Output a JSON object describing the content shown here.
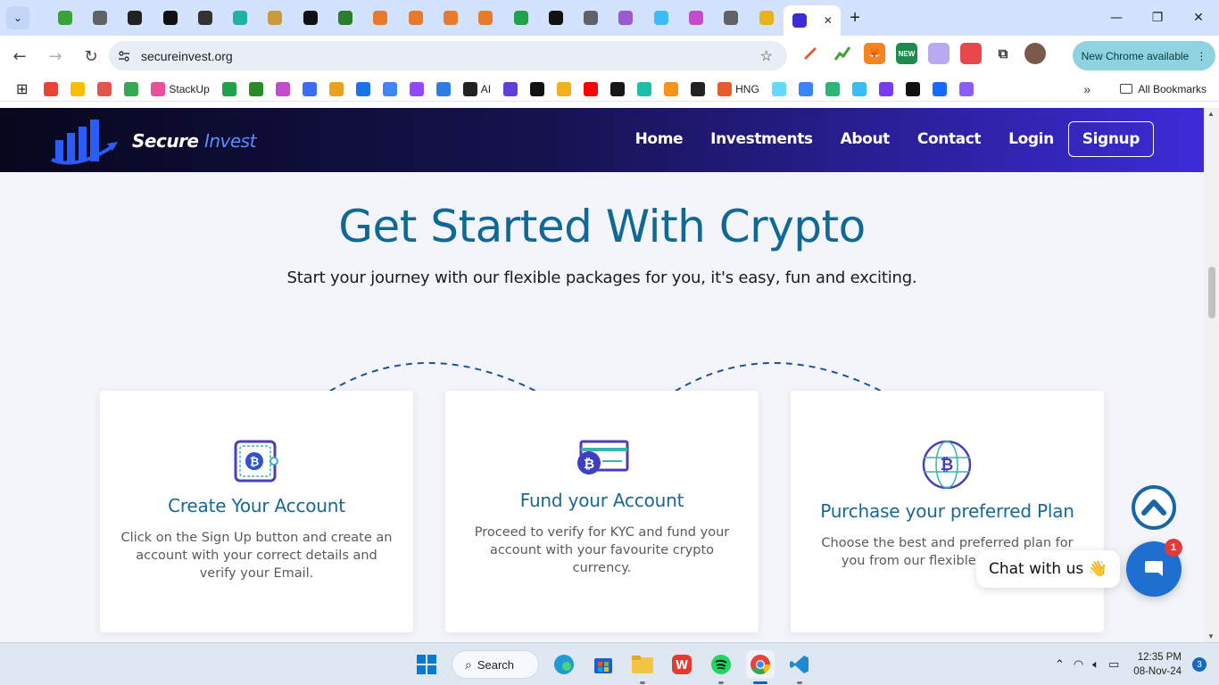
{
  "browser": {
    "tab_count_icons": [
      "chart-icon",
      "globe-icon",
      "tradingview-icon",
      "notion-icon",
      "openai-icon",
      "app-icon",
      "pinata-icon",
      "x-icon",
      "leaf-icon",
      "link-icon",
      "link-icon",
      "link-icon",
      "link-icon",
      "badge-85-icon",
      "block-icon",
      "globe-icon",
      "pin-icon",
      "wave-icon",
      "react-icon",
      "globe-icon",
      "bot-icon",
      "secureinvest-icon"
    ],
    "active_tab_close": "✕",
    "new_tab": "+",
    "url": "secureinvest.org",
    "update_button": "New Chrome available",
    "update_more": "⋮",
    "bookmarks": [
      {
        "label": "",
        "color": "#ea4335"
      },
      {
        "label": "",
        "color": "#fbbc04"
      },
      {
        "label": "",
        "color": "#e0564b"
      },
      {
        "label": "",
        "color": "#34a853"
      },
      {
        "label": "StackUp",
        "color": "#e94f9b"
      },
      {
        "label": "",
        "color": "#1fa34a"
      },
      {
        "label": "",
        "color": "#2a8a2a"
      },
      {
        "label": "",
        "color": "#c44bc9"
      },
      {
        "label": "",
        "color": "#3a6df0"
      },
      {
        "label": "",
        "color": "#e8a31c"
      },
      {
        "label": "",
        "color": "#1a73e8"
      },
      {
        "label": "",
        "color": "#4285f4"
      },
      {
        "label": "",
        "color": "#9146ff"
      },
      {
        "label": "",
        "color": "#2f7de1"
      },
      {
        "label": "AI",
        "color": "#222222"
      },
      {
        "label": "",
        "color": "#5d3fd3"
      },
      {
        "label": "",
        "color": "#111111"
      },
      {
        "label": "",
        "color": "#f2b01e"
      },
      {
        "label": "",
        "color": "#ff0000"
      },
      {
        "label": "",
        "color": "#181717"
      },
      {
        "label": "",
        "color": "#1dbfa7"
      },
      {
        "label": "",
        "color": "#f7931a"
      },
      {
        "label": "",
        "color": "#222222"
      },
      {
        "label": "HNG",
        "color": "#e55b2d"
      },
      {
        "label": "",
        "color": "#61dafb"
      },
      {
        "label": "",
        "color": "#3b82f6"
      },
      {
        "label": "",
        "color": "#2bb673"
      },
      {
        "label": "",
        "color": "#38bdf8"
      },
      {
        "label": "",
        "color": "#7c3aed"
      },
      {
        "label": "",
        "color": "#111111"
      },
      {
        "label": "",
        "color": "#1769ff"
      },
      {
        "label": "",
        "color": "#8b5cf6"
      }
    ],
    "bookmarks_more": "»",
    "all_bookmarks": "All Bookmarks"
  },
  "site": {
    "brand_primary": "Secure",
    "brand_accent": "Invest",
    "nav": [
      "Home",
      "Investments",
      "About",
      "Contact",
      "Login",
      "Signup"
    ],
    "hero_title": "Get Started With Crypto",
    "hero_subtitle": "Start your journey with our flexible packages for you, it's easy, fun and exciting.",
    "cards": [
      {
        "icon": "bitcoin-wallet-icon",
        "title": "Create Your Account",
        "body": "Click on the Sign Up button and create an account with your correct details and verify your Email."
      },
      {
        "icon": "bitcoin-card-icon",
        "title": "Fund your Account",
        "body": "Proceed to verify for KYC and fund your account with your favourite crypto currency."
      },
      {
        "icon": "bitcoin-globe-icon",
        "title": "Purchase your preferred Plan",
        "body": "Choose the best and preferred plan for you from our flexible investment"
      }
    ],
    "chat_label": "Chat with us 👋",
    "chat_badge": "1"
  },
  "taskbar": {
    "search_label": "Search",
    "time": "12:35 PM",
    "date": "08-Nov-24",
    "notifications": "3"
  },
  "colors": {
    "accent_blue": "#106897",
    "nav_gradient_end": "#3d2bd8",
    "chrome_blue": "#d3e3fd"
  }
}
